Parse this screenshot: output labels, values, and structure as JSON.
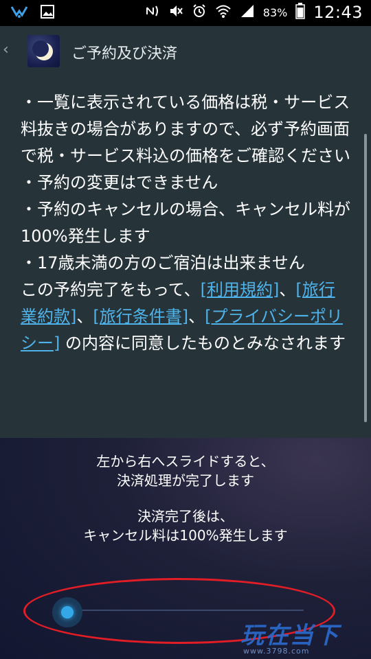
{
  "status_bar": {
    "time": "12:43",
    "battery_percent": "83%",
    "icons": [
      "app-notification-icon",
      "image-icon",
      "nfc-icon",
      "mute-icon",
      "alarm-icon",
      "wifi-icon",
      "signal-icon",
      "battery-icon"
    ]
  },
  "action_bar": {
    "back": "‹",
    "title": "ご予約及び決済"
  },
  "content": {
    "line1": "・一覧に表示されている価格は税・サービス料抜きの場合がありますので、必ず予約画面で税・サービス料込の価格をご確認ください",
    "line2": "・予約の変更はできません",
    "line3": "・予約のキャンセルの場合、キャンセル料が100%発生します",
    "line4": "・17歳未満の方のご宿泊は出来ません",
    "agree_prefix": "この予約完了をもって、",
    "link_terms": "[利用規約]",
    "sep1": "、",
    "link_travel_terms": "[旅行業約款]",
    "sep2": "、",
    "link_conditions": "[旅行条件書]",
    "sep3": "、",
    "link_privacy": "[プライバシーポリシー]",
    "agree_suffix": " の内容に同意したものとみなされます"
  },
  "slide_panel": {
    "instruction_line1": "左から右へスライドすると、",
    "instruction_line2": "決済処理が完了します",
    "notice_line1": "決済完了後は、",
    "notice_line2": "キャンセル料は100%発生します",
    "slider_progress": 0
  },
  "watermark": {
    "text": "玩在当下",
    "sub": "www.3798.com"
  },
  "colors": {
    "background": "#26343a",
    "link": "#4fb3ea",
    "slider_knob": "#34a7e8",
    "annotation_red": "#e21d25"
  }
}
